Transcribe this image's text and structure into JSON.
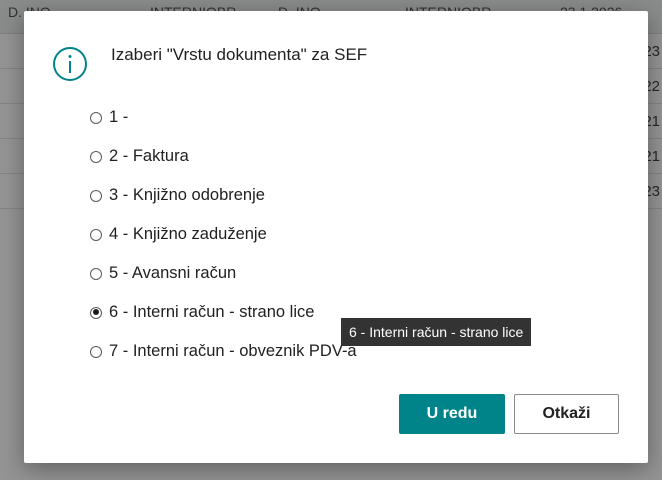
{
  "background": {
    "header_columns": [
      "D. INO",
      "INTERNIOBR",
      "D. INO",
      "INTERNIOBR",
      "23.1.2026"
    ],
    "row_values": [
      "23",
      "22",
      "21",
      "21",
      "23"
    ]
  },
  "dialog": {
    "title": "Izaberi \"Vrstu dokumenta\" za SEF",
    "icon": "info-icon",
    "options": [
      {
        "label": "1 -",
        "checked": false
      },
      {
        "label": "2 - Faktura",
        "checked": false
      },
      {
        "label": "3 - Knjižno odobrenje",
        "checked": false
      },
      {
        "label": "4 - Knjižno zaduženje",
        "checked": false
      },
      {
        "label": "5 - Avansni račun",
        "checked": false
      },
      {
        "label": "6 - Interni račun - strano lice",
        "checked": true
      },
      {
        "label": "7 - Interni račun - obveznik PDV-a",
        "checked": false
      }
    ],
    "tooltip": "6 - Interni račun - strano lice",
    "ok_label": "U redu",
    "cancel_label": "Otkaži"
  },
  "colors": {
    "accent": "#008489",
    "tooltip_bg": "#333333"
  }
}
